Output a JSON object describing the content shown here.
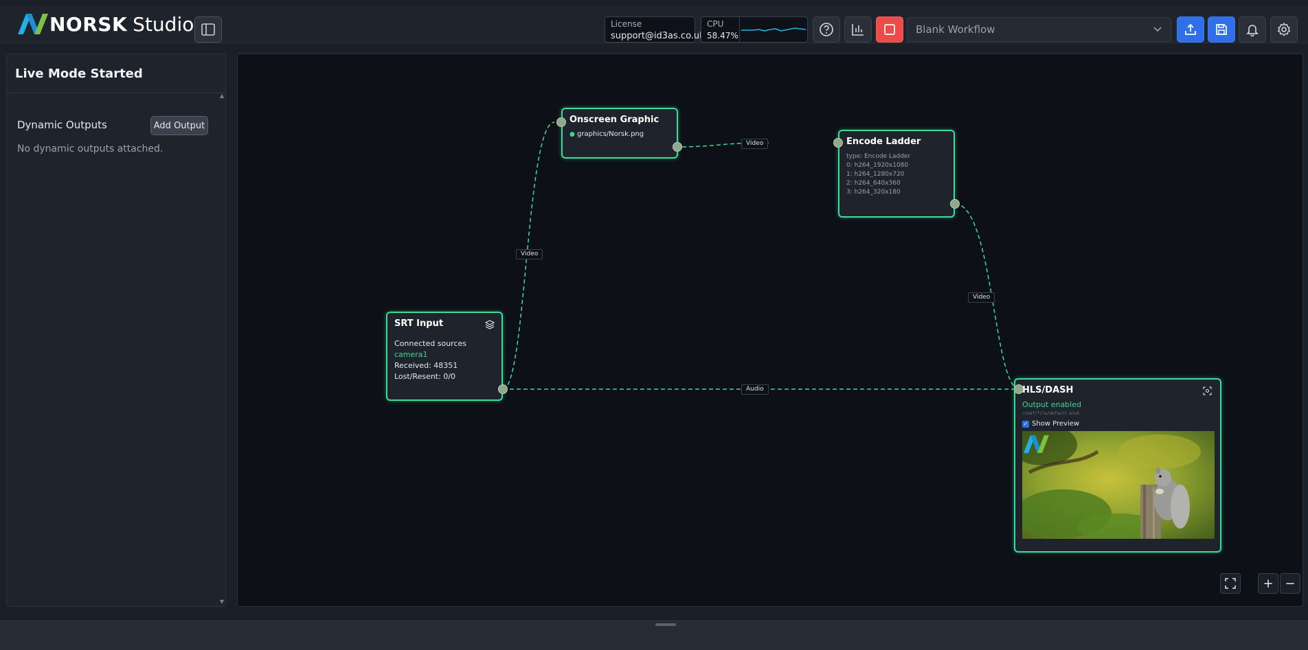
{
  "header": {
    "brand": "NORSK",
    "product": "Studio",
    "license_label": "License",
    "license_value": "support@id3as.co.uk",
    "cpu_label": "CPU",
    "cpu_value": "58.47%",
    "workflow_selected": "Blank Workflow",
    "colors": {
      "accent_blue": "#2f6fe8",
      "stop_red": "#ef4a4a",
      "cpu_line": "#22b8e0"
    },
    "icons": [
      "sidebar-icon",
      "help-icon",
      "stats-icon",
      "stop-icon",
      "chevron-down-icon",
      "upload-icon",
      "save-icon",
      "bell-icon",
      "gear-icon"
    ]
  },
  "sidebar": {
    "title": "Live Mode Started",
    "dynamic_outputs_title": "Dynamic Outputs",
    "add_output_label": "Add Output",
    "empty_text": "No dynamic outputs attached."
  },
  "workflow": {
    "node_border_color": "#3ddc97",
    "srt_input": {
      "title": "SRT Input",
      "connected_sources_label": "Connected sources",
      "source": "camera1",
      "received": "Received: 48351",
      "lost_resent": "Lost/Resent: 0/0"
    },
    "onscreen_graphic": {
      "title": "Onscreen Graphic",
      "file": "graphics/Norsk.png"
    },
    "encode_ladder": {
      "title": "Encode Ladder",
      "type": "type: Encode Ladder",
      "rungs": [
        "0: h264_1920x1080",
        "1: h264_1280x720",
        "2: h264_640x360",
        "3: h264_320x180"
      ]
    },
    "hls_dash": {
      "title": "HLS/DASH",
      "status": "Output enabled",
      "path": "/cmaf/file/default.m3u8",
      "show_preview_label": "Show Preview",
      "show_preview_checked": true
    },
    "edge_labels": {
      "srt_to_graphic": "Video",
      "graphic_to_ladder": "Video",
      "ladder_to_hls": "Video",
      "srt_to_hls": "Audio"
    }
  }
}
